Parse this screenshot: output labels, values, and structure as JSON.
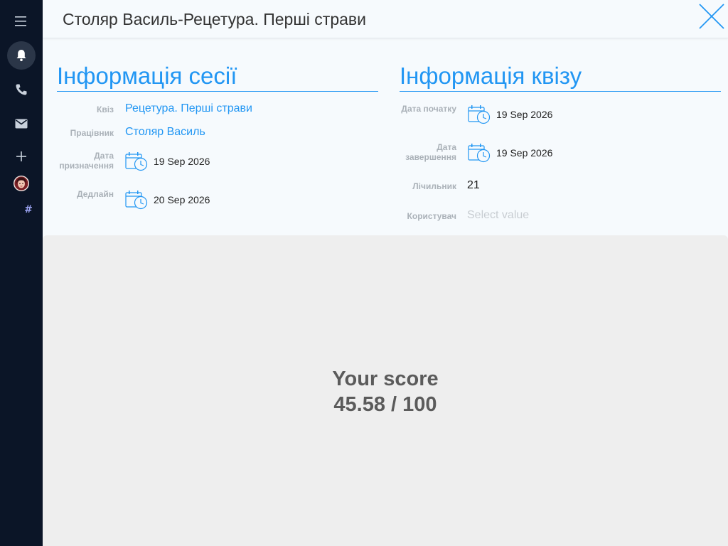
{
  "sidebar": {
    "items": [
      {
        "name": "menu-icon"
      },
      {
        "name": "bell-icon",
        "active": true
      },
      {
        "name": "phone-icon"
      },
      {
        "name": "mail-icon"
      },
      {
        "name": "plus-icon"
      },
      {
        "name": "avatar"
      },
      {
        "name": "hash-icon",
        "label": "#"
      }
    ]
  },
  "header": {
    "title": "Столяр Василь-Рецетура. Перші страви"
  },
  "session_info": {
    "title": "Інформація сесії",
    "quiz_label": "Квіз",
    "quiz_value": "Рецетура. Перші страви",
    "employee_label": "Працівник",
    "employee_value": "Столяр Василь",
    "assigned_label_1": "Дата",
    "assigned_label_2": "призначення",
    "assigned_value": "19 Sep 2026",
    "deadline_label": "Дедлайн",
    "deadline_value": "20 Sep 2026"
  },
  "quiz_info": {
    "title": "Інформація квізу",
    "start_label": "Дата початку",
    "start_value": "19 Sep 2026",
    "end_label_1": "Дата",
    "end_label_2": "завершення",
    "end_value": "19 Sep 2026",
    "counter_label": "Лічильник",
    "counter_value": "21",
    "user_label": "Користувач",
    "user_placeholder": "Select value"
  },
  "score": {
    "title": "Your score",
    "value": "45.58 / 100"
  },
  "colors": {
    "accent": "#2196f3",
    "sidebar": "#0b1527",
    "score_text": "#5b5b5b"
  }
}
